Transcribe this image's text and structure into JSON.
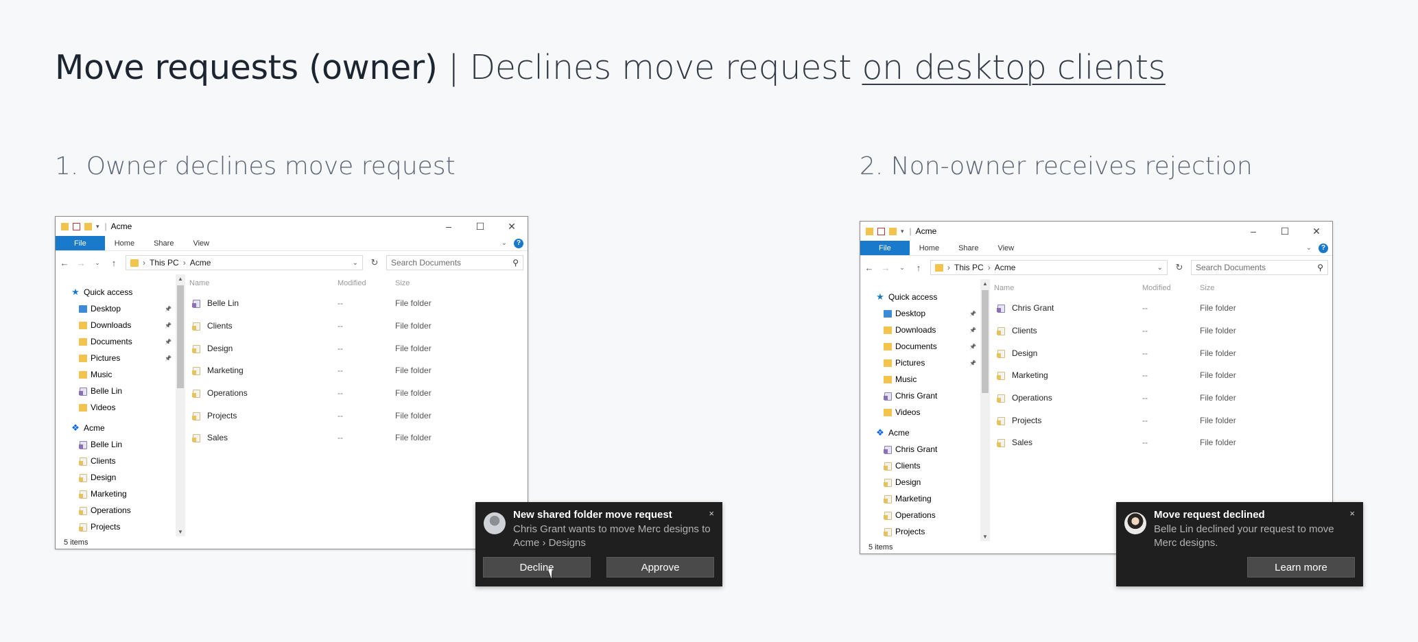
{
  "page": {
    "title_bold": "Move requests (owner)",
    "title_separator": " | ",
    "title_light": "Declines move request ",
    "title_link": "on desktop clients"
  },
  "step1": {
    "heading": "1. Owner declines move request",
    "window": {
      "title": "Acme",
      "ribbon_tabs": [
        "File",
        "Home",
        "Share",
        "View"
      ],
      "address": [
        "This PC",
        "Acme"
      ],
      "search_placeholder": "Search Documents",
      "columns": [
        "Name",
        "Modified",
        "Size"
      ],
      "nav": [
        {
          "label": "Quick access",
          "icon": "star-icon",
          "indent": 0
        },
        {
          "label": "Desktop",
          "icon": "blue",
          "indent": 1,
          "pinned": true
        },
        {
          "label": "Downloads",
          "icon": "yellow",
          "indent": 1,
          "pinned": true
        },
        {
          "label": "Documents",
          "icon": "yellow",
          "indent": 1,
          "pinned": true
        },
        {
          "label": "Pictures",
          "icon": "yellow",
          "indent": 1,
          "pinned": true
        },
        {
          "label": "Music",
          "icon": "yellow",
          "indent": 1
        },
        {
          "label": "Belle Lin",
          "icon": "user",
          "indent": 1
        },
        {
          "label": "Videos",
          "icon": "yellow",
          "indent": 1
        },
        {
          "label": "Acme",
          "icon": "dropbox-icon",
          "indent": 0,
          "gap": true
        },
        {
          "label": "Belle Lin",
          "icon": "user",
          "indent": 1
        },
        {
          "label": "Clients",
          "icon": "folder",
          "indent": 1
        },
        {
          "label": "Design",
          "icon": "folder",
          "indent": 1
        },
        {
          "label": "Marketing",
          "icon": "folder",
          "indent": 1
        },
        {
          "label": "Operations",
          "icon": "folder",
          "indent": 1
        },
        {
          "label": "Projects",
          "icon": "folder",
          "indent": 1
        }
      ],
      "rows": [
        {
          "name": "Belle Lin",
          "modified": "--",
          "size": "File folder",
          "icon": "user"
        },
        {
          "name": "Clients",
          "modified": "--",
          "size": "File folder",
          "icon": "folder"
        },
        {
          "name": "Design",
          "modified": "--",
          "size": "File folder",
          "icon": "folder"
        },
        {
          "name": "Marketing",
          "modified": "--",
          "size": "File folder",
          "icon": "folder"
        },
        {
          "name": "Operations",
          "modified": "--",
          "size": "File folder",
          "icon": "folder"
        },
        {
          "name": "Projects",
          "modified": "--",
          "size": "File folder",
          "icon": "folder"
        },
        {
          "name": "Sales",
          "modified": "--",
          "size": "File folder",
          "icon": "folder"
        }
      ],
      "status": "5 items"
    },
    "toast": {
      "title": "New shared folder move request",
      "body": "Chris Grant wants to move Merc designs to Acme › Designs",
      "decline_label": "Decline",
      "approve_label": "Approve",
      "close": "×"
    }
  },
  "step2": {
    "heading": "2. Non-owner receives rejection",
    "window": {
      "title": "Acme",
      "ribbon_tabs": [
        "File",
        "Home",
        "Share",
        "View"
      ],
      "address": [
        "This PC",
        "Acme"
      ],
      "search_placeholder": "Search Documents",
      "columns": [
        "Name",
        "Modified",
        "Size"
      ],
      "nav": [
        {
          "label": "Quick access",
          "icon": "star-icon",
          "indent": 0
        },
        {
          "label": "Desktop",
          "icon": "blue",
          "indent": 1,
          "pinned": true
        },
        {
          "label": "Downloads",
          "icon": "yellow",
          "indent": 1,
          "pinned": true
        },
        {
          "label": "Documents",
          "icon": "yellow",
          "indent": 1,
          "pinned": true
        },
        {
          "label": "Pictures",
          "icon": "yellow",
          "indent": 1,
          "pinned": true
        },
        {
          "label": "Music",
          "icon": "yellow",
          "indent": 1
        },
        {
          "label": "Chris Grant",
          "icon": "user",
          "indent": 1
        },
        {
          "label": "Videos",
          "icon": "yellow",
          "indent": 1
        },
        {
          "label": "Acme",
          "icon": "dropbox-icon",
          "indent": 0,
          "gap": true
        },
        {
          "label": "Chris Grant",
          "icon": "user",
          "indent": 1
        },
        {
          "label": "Clients",
          "icon": "folder",
          "indent": 1
        },
        {
          "label": "Design",
          "icon": "folder",
          "indent": 1
        },
        {
          "label": "Marketing",
          "icon": "folder",
          "indent": 1
        },
        {
          "label": "Operations",
          "icon": "folder",
          "indent": 1
        },
        {
          "label": "Projects",
          "icon": "folder",
          "indent": 1
        }
      ],
      "rows": [
        {
          "name": "Chris Grant",
          "modified": "--",
          "size": "File folder",
          "icon": "user"
        },
        {
          "name": "Clients",
          "modified": "--",
          "size": "File folder",
          "icon": "folder"
        },
        {
          "name": "Design",
          "modified": "--",
          "size": "File folder",
          "icon": "folder"
        },
        {
          "name": "Marketing",
          "modified": "--",
          "size": "File folder",
          "icon": "folder"
        },
        {
          "name": "Operations",
          "modified": "--",
          "size": "File folder",
          "icon": "folder"
        },
        {
          "name": "Projects",
          "modified": "--",
          "size": "File folder",
          "icon": "folder"
        },
        {
          "name": "Sales",
          "modified": "--",
          "size": "File folder",
          "icon": "folder"
        }
      ],
      "status": "5 items"
    },
    "toast": {
      "title": "Move request declined",
      "body": "Belle Lin declined your request to move Merc designs.",
      "learn_more_label": "Learn more",
      "close": "×"
    }
  }
}
